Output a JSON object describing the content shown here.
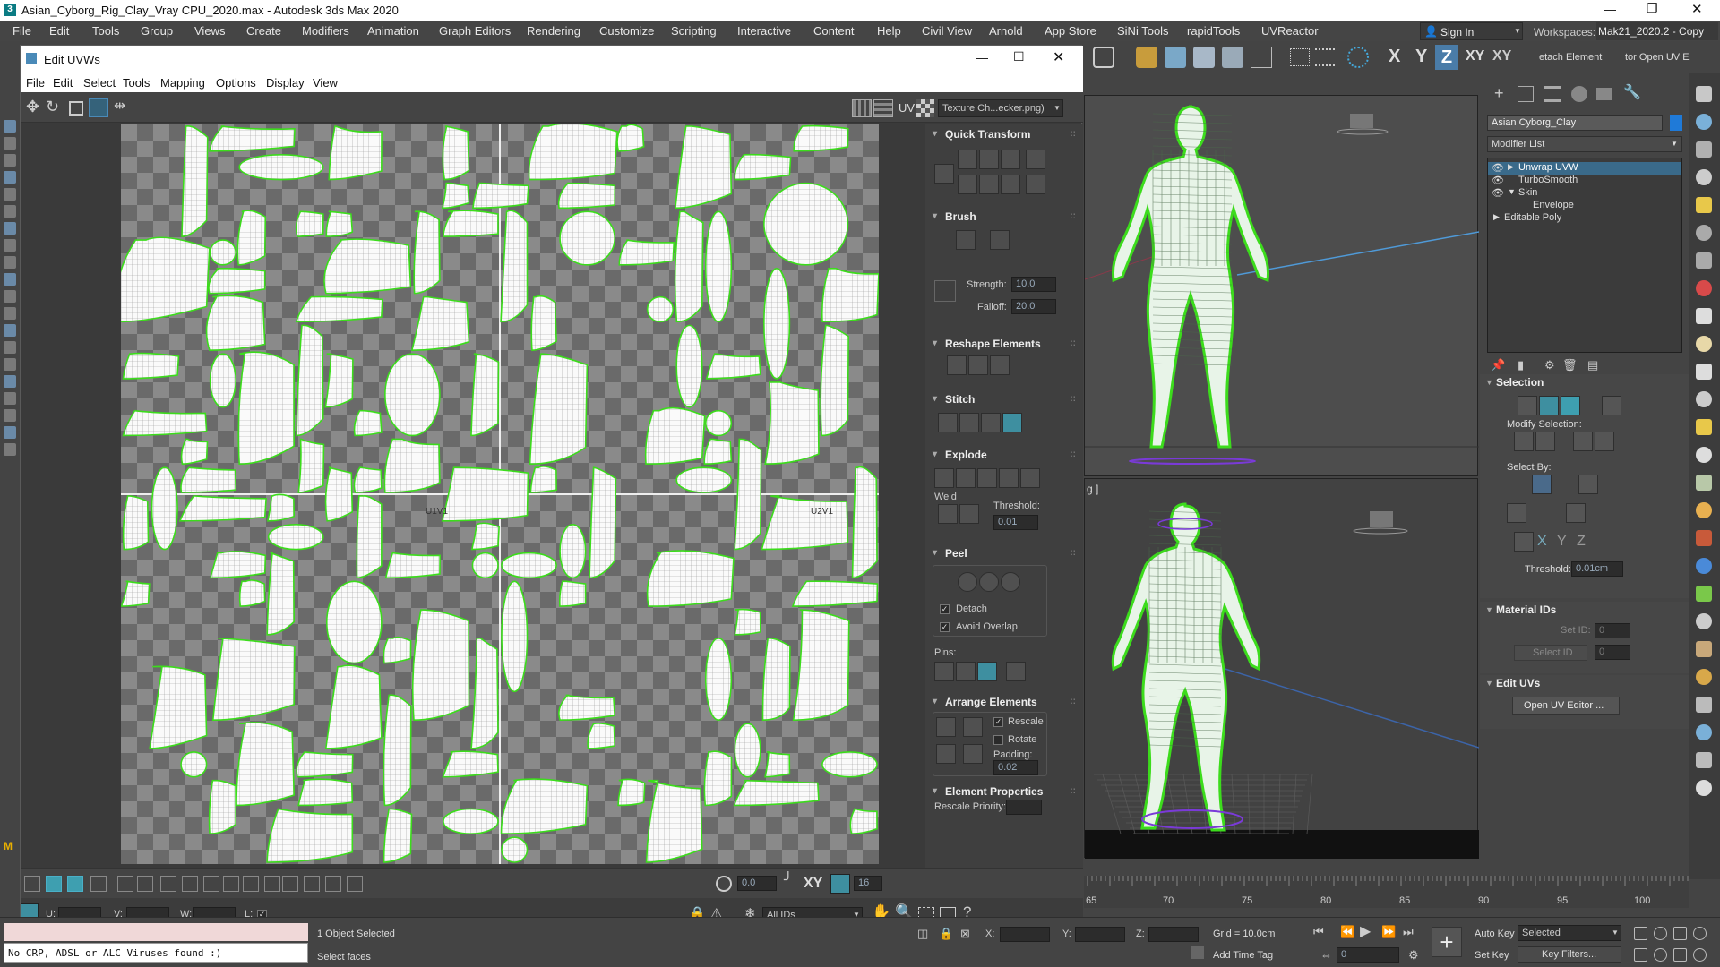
{
  "app_title": "Asian_Cyborg_Rig_Clay_Vray CPU_2020.max - Autodesk 3ds Max 2020",
  "menu": [
    "File",
    "Edit",
    "Tools",
    "Group",
    "Views",
    "Create",
    "Modifiers",
    "Animation",
    "Graph Editors",
    "Rendering",
    "Customize",
    "Scripting",
    "Interactive",
    "Content",
    "Help",
    "Civil View",
    "Arnold",
    "App Store",
    "SiNi Tools",
    "rapidTools",
    "UVReactor"
  ],
  "sign_in": "Sign In",
  "workspaces_label": "Workspaces:",
  "workspace_value": "Mak21_2020.2 - Copy",
  "axis_buttons": [
    "X",
    "Y",
    "Z",
    "XY",
    "XY"
  ],
  "detach_text": "etach Element",
  "open_uv_text": "tor Open UV E",
  "uvw": {
    "title": "Edit UVWs",
    "menu": [
      "File",
      "Edit",
      "Select",
      "Tools",
      "Mapping",
      "Options",
      "Display",
      "View"
    ],
    "uv_label": "UV",
    "texture_select": "Texture Ch...ecker.png)",
    "tile_labels": [
      "",
      "",
      "U1V1",
      "U2V1"
    ],
    "rollouts": {
      "quick_transform": "Quick Transform",
      "brush": "Brush",
      "strength_label": "Strength:",
      "strength_value": "10.0",
      "falloff_label": "Falloff:",
      "falloff_value": "20.0",
      "reshape": "Reshape Elements",
      "stitch": "Stitch",
      "explode": "Explode",
      "weld_label": "Weld",
      "threshold_label": "Threshold:",
      "threshold_value": "0.01",
      "peel": "Peel",
      "detach_label": "Detach",
      "avoid_overlap_label": "Avoid Overlap",
      "pins_label": "Pins:",
      "arrange": "Arrange Elements",
      "rescale_label": "Rescale",
      "rotate_label": "Rotate",
      "padding_label": "Padding:",
      "padding_value": "0.02",
      "element_props": "Element Properties",
      "rescale_priority_label": "Rescale Priority:"
    },
    "bottom": {
      "angle_value": "0.0",
      "xy_label": "XY",
      "grid_value": "16",
      "u_label": "U:",
      "v_label": "V:",
      "w_label": "W:",
      "l_label": "L:",
      "ids_select": "All IDs"
    }
  },
  "viewport2_label": "g ]",
  "command_panel": {
    "object_name": "Asian Cyborg_Clay",
    "modifier_list": "Modifier List",
    "stack": [
      "Unwrap UVW",
      "TurboSmooth",
      "Skin",
      "Envelope",
      "Editable Poly"
    ],
    "selection": "Selection",
    "modify_selection": "Modify Selection:",
    "select_by": "Select By:",
    "threshold_label": "Threshold:",
    "threshold_value": "0.01cm",
    "material_ids": "Material IDs",
    "set_id": "Set ID:",
    "set_id_value": "0",
    "select_id": "Select ID",
    "select_id_value": "0",
    "edit_uvs": "Edit UVs",
    "open_uv_editor": "Open UV Editor ..."
  },
  "timeline_ticks": [
    "65",
    "70",
    "75",
    "80",
    "85",
    "90",
    "95",
    "100"
  ],
  "status": {
    "maxscript_label": "M",
    "listener_text": "No CRP, ADSL or ALC Viruses found :)",
    "selected_text": "1 Object Selected",
    "prompt_text": "Select faces",
    "x_label": "X:",
    "y_label": "Y:",
    "z_label": "Z:",
    "grid_text": "Grid = 10.0cm",
    "add_time_tag": "Add Time Tag",
    "auto_key": "Auto Key",
    "set_key": "Set Key",
    "selected_dropdown": "Selected",
    "key_filters": "Key Filters...",
    "frame_value": "0"
  },
  "colors": {
    "accent": "#3e9fb0",
    "uv_green": "#3cdc1c",
    "wire": "#ffffff"
  }
}
